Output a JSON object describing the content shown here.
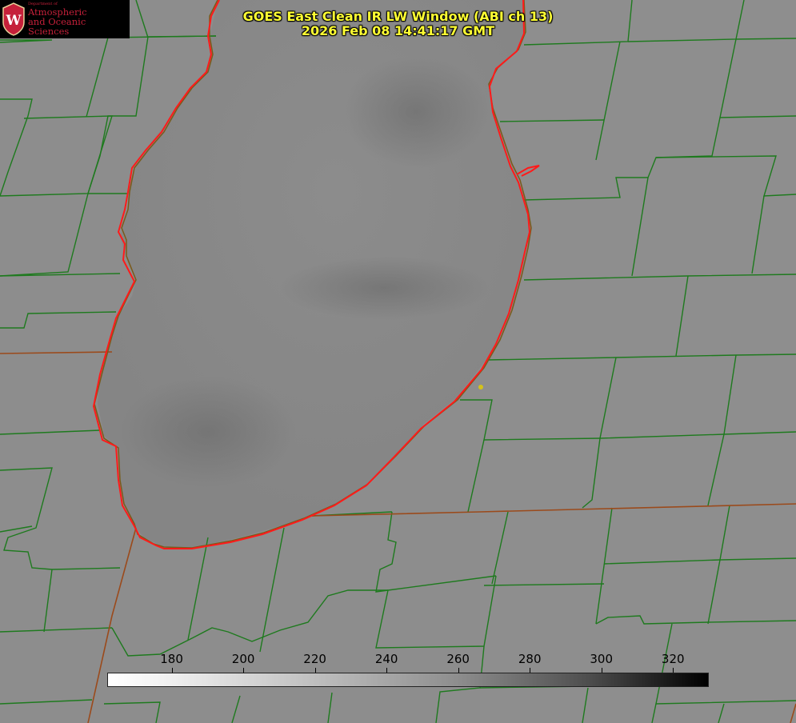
{
  "title_line1": "GOES East Clean IR LW Window (ABI ch 13)",
  "title_line2": "2026 Feb 08 14:41:17 GMT",
  "logo": {
    "dept": "Department of",
    "line1": "Atmospheric",
    "line2": "and Oceanic Sciences",
    "crest_letter": "W",
    "color": "#c5203a"
  },
  "colorbar": {
    "ticks": [
      "180",
      "200",
      "220",
      "240",
      "260",
      "280",
      "300",
      "320"
    ],
    "range": [
      162,
      330
    ],
    "colormap": "white-to-black"
  },
  "colors": {
    "county_lines": "#1e7a1e",
    "state_lines": "#8b4513",
    "coastline": "#ff2020",
    "title": "#ffff33",
    "station_dot": "#d4c21a"
  }
}
